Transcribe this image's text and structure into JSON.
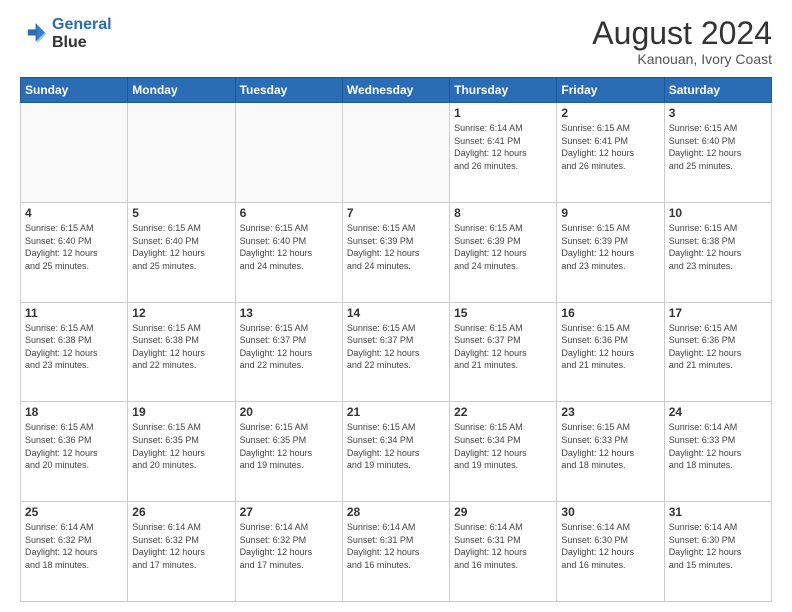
{
  "header": {
    "logo_line1": "General",
    "logo_line2": "Blue",
    "main_title": "August 2024",
    "subtitle": "Kanouan, Ivory Coast"
  },
  "calendar": {
    "days_of_week": [
      "Sunday",
      "Monday",
      "Tuesday",
      "Wednesday",
      "Thursday",
      "Friday",
      "Saturday"
    ],
    "weeks": [
      [
        {
          "day": "",
          "info": ""
        },
        {
          "day": "",
          "info": ""
        },
        {
          "day": "",
          "info": ""
        },
        {
          "day": "",
          "info": ""
        },
        {
          "day": "1",
          "info": "Sunrise: 6:14 AM\nSunset: 6:41 PM\nDaylight: 12 hours\nand 26 minutes."
        },
        {
          "day": "2",
          "info": "Sunrise: 6:15 AM\nSunset: 6:41 PM\nDaylight: 12 hours\nand 26 minutes."
        },
        {
          "day": "3",
          "info": "Sunrise: 6:15 AM\nSunset: 6:40 PM\nDaylight: 12 hours\nand 25 minutes."
        }
      ],
      [
        {
          "day": "4",
          "info": "Sunrise: 6:15 AM\nSunset: 6:40 PM\nDaylight: 12 hours\nand 25 minutes."
        },
        {
          "day": "5",
          "info": "Sunrise: 6:15 AM\nSunset: 6:40 PM\nDaylight: 12 hours\nand 25 minutes."
        },
        {
          "day": "6",
          "info": "Sunrise: 6:15 AM\nSunset: 6:40 PM\nDaylight: 12 hours\nand 24 minutes."
        },
        {
          "day": "7",
          "info": "Sunrise: 6:15 AM\nSunset: 6:39 PM\nDaylight: 12 hours\nand 24 minutes."
        },
        {
          "day": "8",
          "info": "Sunrise: 6:15 AM\nSunset: 6:39 PM\nDaylight: 12 hours\nand 24 minutes."
        },
        {
          "day": "9",
          "info": "Sunrise: 6:15 AM\nSunset: 6:39 PM\nDaylight: 12 hours\nand 23 minutes."
        },
        {
          "day": "10",
          "info": "Sunrise: 6:15 AM\nSunset: 6:38 PM\nDaylight: 12 hours\nand 23 minutes."
        }
      ],
      [
        {
          "day": "11",
          "info": "Sunrise: 6:15 AM\nSunset: 6:38 PM\nDaylight: 12 hours\nand 23 minutes."
        },
        {
          "day": "12",
          "info": "Sunrise: 6:15 AM\nSunset: 6:38 PM\nDaylight: 12 hours\nand 22 minutes."
        },
        {
          "day": "13",
          "info": "Sunrise: 6:15 AM\nSunset: 6:37 PM\nDaylight: 12 hours\nand 22 minutes."
        },
        {
          "day": "14",
          "info": "Sunrise: 6:15 AM\nSunset: 6:37 PM\nDaylight: 12 hours\nand 22 minutes."
        },
        {
          "day": "15",
          "info": "Sunrise: 6:15 AM\nSunset: 6:37 PM\nDaylight: 12 hours\nand 21 minutes."
        },
        {
          "day": "16",
          "info": "Sunrise: 6:15 AM\nSunset: 6:36 PM\nDaylight: 12 hours\nand 21 minutes."
        },
        {
          "day": "17",
          "info": "Sunrise: 6:15 AM\nSunset: 6:36 PM\nDaylight: 12 hours\nand 21 minutes."
        }
      ],
      [
        {
          "day": "18",
          "info": "Sunrise: 6:15 AM\nSunset: 6:36 PM\nDaylight: 12 hours\nand 20 minutes."
        },
        {
          "day": "19",
          "info": "Sunrise: 6:15 AM\nSunset: 6:35 PM\nDaylight: 12 hours\nand 20 minutes."
        },
        {
          "day": "20",
          "info": "Sunrise: 6:15 AM\nSunset: 6:35 PM\nDaylight: 12 hours\nand 19 minutes."
        },
        {
          "day": "21",
          "info": "Sunrise: 6:15 AM\nSunset: 6:34 PM\nDaylight: 12 hours\nand 19 minutes."
        },
        {
          "day": "22",
          "info": "Sunrise: 6:15 AM\nSunset: 6:34 PM\nDaylight: 12 hours\nand 19 minutes."
        },
        {
          "day": "23",
          "info": "Sunrise: 6:15 AM\nSunset: 6:33 PM\nDaylight: 12 hours\nand 18 minutes."
        },
        {
          "day": "24",
          "info": "Sunrise: 6:14 AM\nSunset: 6:33 PM\nDaylight: 12 hours\nand 18 minutes."
        }
      ],
      [
        {
          "day": "25",
          "info": "Sunrise: 6:14 AM\nSunset: 6:32 PM\nDaylight: 12 hours\nand 18 minutes."
        },
        {
          "day": "26",
          "info": "Sunrise: 6:14 AM\nSunset: 6:32 PM\nDaylight: 12 hours\nand 17 minutes."
        },
        {
          "day": "27",
          "info": "Sunrise: 6:14 AM\nSunset: 6:32 PM\nDaylight: 12 hours\nand 17 minutes."
        },
        {
          "day": "28",
          "info": "Sunrise: 6:14 AM\nSunset: 6:31 PM\nDaylight: 12 hours\nand 16 minutes."
        },
        {
          "day": "29",
          "info": "Sunrise: 6:14 AM\nSunset: 6:31 PM\nDaylight: 12 hours\nand 16 minutes."
        },
        {
          "day": "30",
          "info": "Sunrise: 6:14 AM\nSunset: 6:30 PM\nDaylight: 12 hours\nand 16 minutes."
        },
        {
          "day": "31",
          "info": "Sunrise: 6:14 AM\nSunset: 6:30 PM\nDaylight: 12 hours\nand 15 minutes."
        }
      ]
    ]
  }
}
